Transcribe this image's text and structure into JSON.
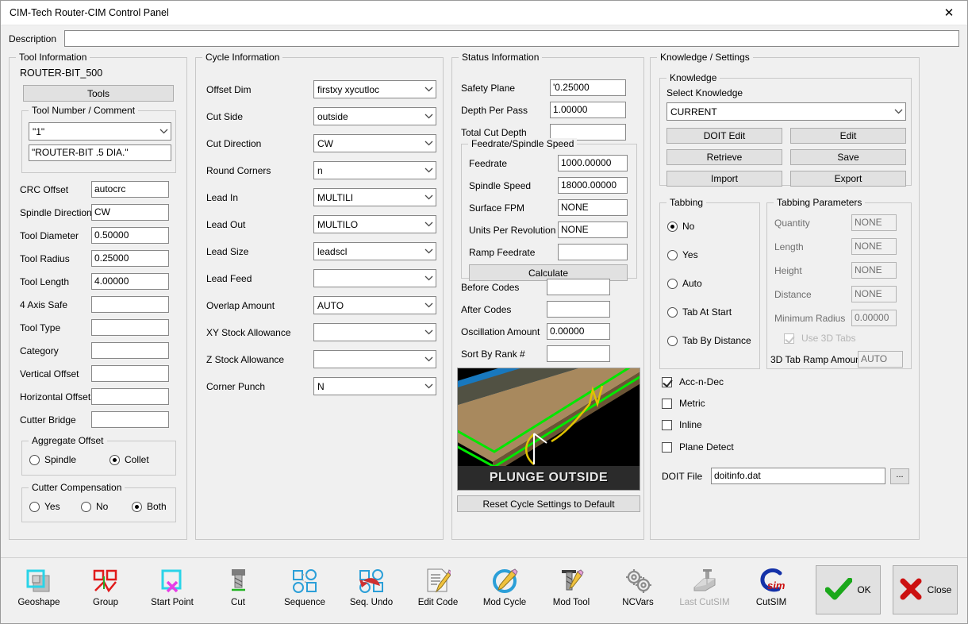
{
  "window": {
    "title": "CIM-Tech Router-CIM Control Panel",
    "close_icon": "close-icon"
  },
  "description": {
    "label": "Description",
    "value": "",
    "placeholder": ""
  },
  "tool_information": {
    "title": "Tool Information",
    "tool_name": "ROUTER-BIT_500",
    "tools_button": "Tools",
    "tool_number_comment": {
      "title": "Tool Number / Comment",
      "number": "\"1\"",
      "comment": "\"ROUTER-BIT .5 DIA.\""
    },
    "fields": [
      {
        "label": "CRC Offset",
        "value": "autocrc"
      },
      {
        "label": "Spindle Direction",
        "value": "CW"
      },
      {
        "label": "Tool Diameter",
        "value": "0.50000"
      },
      {
        "label": "Tool Radius",
        "value": "0.25000"
      },
      {
        "label": "Tool Length",
        "value": "4.00000"
      },
      {
        "label": "4 Axis Safe",
        "value": ""
      },
      {
        "label": "Tool Type",
        "value": ""
      },
      {
        "label": "Category",
        "value": ""
      },
      {
        "label": "Vertical Offset",
        "value": ""
      },
      {
        "label": "Horizontal Offset",
        "value": ""
      },
      {
        "label": "Cutter Bridge",
        "value": ""
      }
    ],
    "aggregate_offset": {
      "title": "Aggregate Offset",
      "options": [
        {
          "label": "Spindle",
          "selected": false
        },
        {
          "label": "Collet",
          "selected": true
        }
      ]
    },
    "cutter_compensation": {
      "title": "Cutter Compensation",
      "options": [
        {
          "label": "Yes",
          "selected": false
        },
        {
          "label": "No",
          "selected": false
        },
        {
          "label": "Both",
          "selected": true
        }
      ]
    }
  },
  "cycle_information": {
    "title": "Cycle Information",
    "fields": [
      {
        "label": "Offset Dim",
        "value": "firstxy xycutloc"
      },
      {
        "label": "Cut Side",
        "value": "outside"
      },
      {
        "label": "Cut Direction",
        "value": "CW"
      },
      {
        "label": "Round Corners",
        "value": "n"
      },
      {
        "label": "Lead In",
        "value": "MULTILI"
      },
      {
        "label": "Lead Out",
        "value": "MULTILO"
      },
      {
        "label": "Lead Size",
        "value": "leadscl"
      },
      {
        "label": "Lead Feed",
        "value": ""
      },
      {
        "label": "Overlap Amount",
        "value": "AUTO"
      },
      {
        "label": "XY Stock Allowance",
        "value": ""
      },
      {
        "label": "Z Stock Allowance",
        "value": ""
      },
      {
        "label": "Corner Punch",
        "value": "N"
      }
    ]
  },
  "status_information": {
    "title": "Status Information",
    "top_fields": [
      {
        "label": "Safety Plane",
        "value": "'0.25000"
      },
      {
        "label": "Depth Per Pass",
        "value": "1.00000"
      },
      {
        "label": "Total Cut Depth",
        "value": ""
      }
    ],
    "feedrate_group": {
      "title": "Feedrate/Spindle Speed",
      "fields": [
        {
          "label": "Feedrate",
          "value": "1000.00000"
        },
        {
          "label": "Spindle Speed",
          "value": "18000.00000"
        },
        {
          "label": "Surface FPM",
          "value": "NONE"
        },
        {
          "label": "Units Per Revolution",
          "value": "NONE"
        },
        {
          "label": "Ramp Feedrate",
          "value": ""
        }
      ],
      "calculate_button": "Calculate"
    },
    "bottom_fields": [
      {
        "label": "Before Codes",
        "value": ""
      },
      {
        "label": "After Codes",
        "value": ""
      },
      {
        "label": "Oscillation Amount",
        "value": "0.00000"
      },
      {
        "label": "Sort By Rank #",
        "value": ""
      }
    ],
    "preview": {
      "caption": "PLUNGE OUTSIDE"
    },
    "reset_button": "Reset Cycle Settings to Default"
  },
  "knowledge_settings": {
    "title": "Knowledge / Settings",
    "knowledge": {
      "title": "Knowledge",
      "select_label": "Select Knowledge",
      "selected": "CURRENT",
      "buttons": [
        "DOIT Edit",
        "Edit",
        "Retrieve",
        "Save",
        "Import",
        "Export"
      ]
    },
    "tabbing": {
      "title": "Tabbing",
      "options": [
        {
          "label": "No",
          "selected": true
        },
        {
          "label": "Yes",
          "selected": false
        },
        {
          "label": "Auto",
          "selected": false
        },
        {
          "label": "Tab At Start",
          "selected": false
        },
        {
          "label": "Tab By Distance",
          "selected": false
        }
      ]
    },
    "tabbing_parameters": {
      "title": "Tabbing Parameters",
      "fields": [
        {
          "label": "Quantity",
          "value": "NONE",
          "disabled": true
        },
        {
          "label": "Length",
          "value": "NONE",
          "disabled": true
        },
        {
          "label": "Height",
          "value": "NONE",
          "disabled": true
        },
        {
          "label": "Distance",
          "value": "NONE",
          "disabled": true
        },
        {
          "label": "Minimum Radius",
          "value": "0.00000",
          "disabled": true
        }
      ],
      "use_3d_tabs": {
        "label": "Use 3D Tabs",
        "checked": true,
        "disabled": true
      },
      "ramp": {
        "label": "3D Tab Ramp Amount",
        "value": "AUTO",
        "disabled": true
      }
    },
    "checkboxes": [
      {
        "label": "Acc-n-Dec",
        "checked": true
      },
      {
        "label": "Metric",
        "checked": false
      },
      {
        "label": "Inline",
        "checked": false
      },
      {
        "label": "Plane Detect",
        "checked": false
      }
    ],
    "doit_file": {
      "label": "DOIT File",
      "value": "doitinfo.dat",
      "browse": "..."
    }
  },
  "toolbar": {
    "items": [
      {
        "label": "Geoshape",
        "icon": "geoshape-icon",
        "disabled": false
      },
      {
        "label": "Group",
        "icon": "group-icon",
        "disabled": false
      },
      {
        "label": "Start Point",
        "icon": "start-point-icon",
        "disabled": false
      },
      {
        "label": "Cut",
        "icon": "cut-tool-icon",
        "disabled": false
      },
      {
        "label": "Sequence",
        "icon": "sequence-icon",
        "disabled": false
      },
      {
        "label": "Seq. Undo",
        "icon": "sequence-undo-icon",
        "disabled": false
      },
      {
        "label": "Edit Code",
        "icon": "edit-code-icon",
        "disabled": false
      },
      {
        "label": "Mod Cycle",
        "icon": "mod-cycle-icon",
        "disabled": false
      },
      {
        "label": "Mod Tool",
        "icon": "mod-tool-icon",
        "disabled": false
      },
      {
        "label": "NCVars",
        "icon": "ncvars-gears-icon",
        "disabled": false
      },
      {
        "label": "Last CutSIM",
        "icon": "last-cutsim-icon",
        "disabled": true
      },
      {
        "label": "CutSIM",
        "icon": "cutsim-icon",
        "disabled": false
      }
    ],
    "ok_button": {
      "label": "OK",
      "icon": "green-check-icon"
    },
    "close_button": {
      "label": "Close",
      "icon": "red-x-icon"
    }
  },
  "colors": {
    "dialog_bg": "#f0f0f0",
    "field_border": "#888888",
    "accent_green": "#22a322",
    "accent_red": "#cc2222",
    "preview_blue": "#1878be",
    "preview_tan": "#a8895e",
    "preview_green": "#00e800",
    "preview_yellow": "#e0c200"
  }
}
